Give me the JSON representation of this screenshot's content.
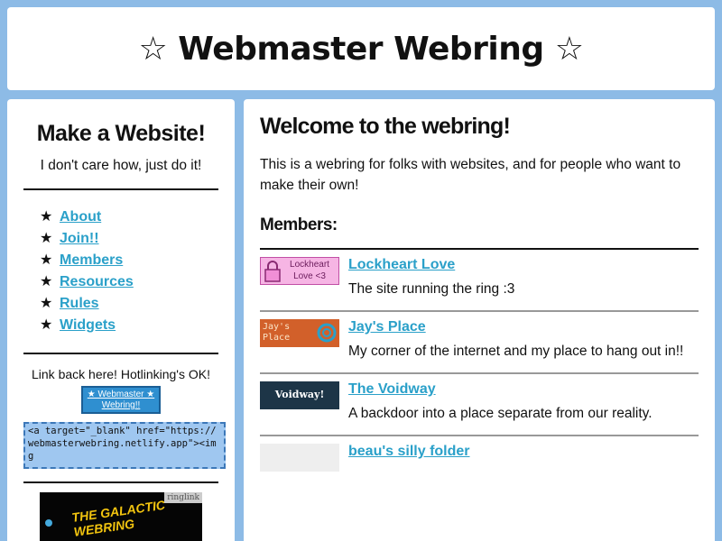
{
  "header": {
    "title": "☆ Webmaster Webring ☆"
  },
  "sidebar": {
    "title": "Make a Website!",
    "subtitle": "I don't care how, just do it!",
    "nav": [
      {
        "icon": "★",
        "label": "About"
      },
      {
        "icon": "★",
        "label": "Join!!"
      },
      {
        "icon": "★",
        "label": "Members"
      },
      {
        "icon": "★",
        "label": "Resources"
      },
      {
        "icon": "★",
        "label": "Rules"
      },
      {
        "icon": "★",
        "label": "Widgets"
      }
    ],
    "linkback_text": "Link back here! Hotlinking's OK!",
    "badge_text": "★ Webmaster ★ Webring!!",
    "code_snippet": "<a target=\"_blank\" href=\"https://webmasterwebring.netlify.app\"><img",
    "ring_tag": "ringlink",
    "ring_banner_text": "THE GALACTIC WEBRING"
  },
  "main": {
    "title": "Welcome to the webring!",
    "intro": "This is a webring for folks with websites, and for people who want to make their own!",
    "members_heading": "Members:",
    "members": [
      {
        "name": "Lockheart Love",
        "desc": "The site running the ring :3",
        "badge": "Lockheart Love <3"
      },
      {
        "name": "Jay's Place",
        "desc": "My corner of the internet and my place to hang out in!!",
        "badge": "Jay's Place"
      },
      {
        "name": "The Voidway",
        "desc": "A backdoor into a place separate from our reality.",
        "badge": "Voidway!"
      },
      {
        "name": "beau's silly folder",
        "desc": "",
        "badge": ""
      }
    ]
  },
  "colors": {
    "background": "#8dbbe6",
    "link": "#2aa0c9",
    "panel": "#ffffff"
  }
}
